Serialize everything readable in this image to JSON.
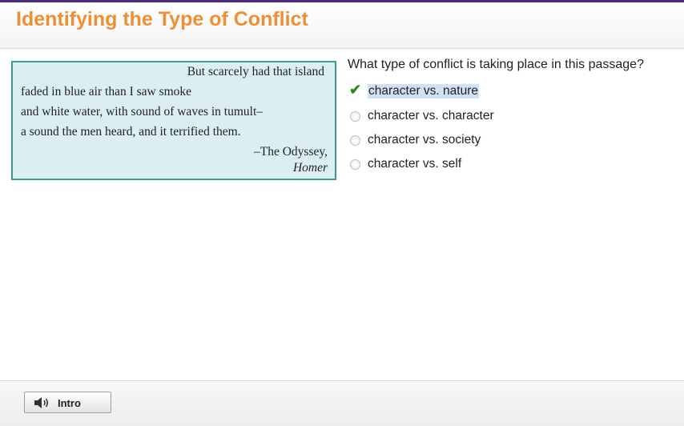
{
  "header": {
    "title": "Identifying the Type of Conflict"
  },
  "passage": {
    "lines": [
      "But scarcely had that island",
      "faded in blue air than I saw smoke",
      "and white water, with sound of waves in tumult–",
      "a sound the men heard, and it terrified them."
    ],
    "source": "–The Odyssey,",
    "author": "Homer"
  },
  "question": {
    "prompt": "What type of conflict is taking place in this passage?",
    "options": [
      {
        "label": "character vs. nature",
        "selected": true
      },
      {
        "label": "character vs. character",
        "selected": false
      },
      {
        "label": "character vs. society",
        "selected": false
      },
      {
        "label": "character vs. self",
        "selected": false
      }
    ]
  },
  "footer": {
    "intro_label": "Intro"
  },
  "colors": {
    "title": "#ee8f35",
    "passage_bg": "#dbeff2",
    "passage_border": "#3d9a8e",
    "check": "#2f8a1f"
  }
}
